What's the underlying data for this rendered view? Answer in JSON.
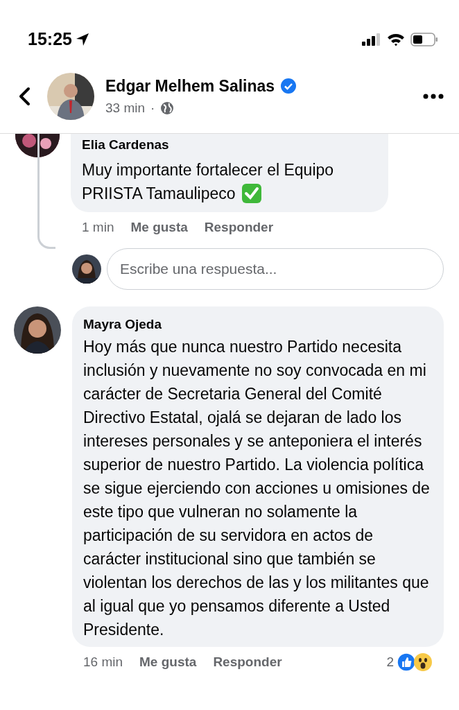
{
  "status_bar": {
    "time": "15:25"
  },
  "header": {
    "name": "Edgar Melhem Salinas",
    "verified": true,
    "time": "33 min",
    "separator": "·"
  },
  "reply_thread": {
    "author": "Elia Cardenas",
    "text_lines": [
      "Muy importante fortalecer el Equipo",
      "PRIISTA Tamaulipeco"
    ],
    "time": "1 min",
    "actions": [
      "Me gusta",
      "Responder"
    ]
  },
  "reply_box": {
    "placeholder": "Escribe una respuesta..."
  },
  "comment": {
    "author": "Mayra Ojeda",
    "text": "Hoy más que nunca nuestro Partido necesita inclusión y nuevamente no soy convocada en mi carácter de Secretaria General del Comité Directivo Estatal, ojalá se dejaran de lado los intereses personales y se anteponiera el interés superior de nuestro Partido. La violencia política se sigue ejerciendo con acciones u omisiones de este tipo que vulneran no solamente la participación de su servidora en actos de carácter institucional sino que también se violentan los derechos de las y los militantes que al igual que yo pensamos diferente a Usted Presidente.",
    "time": "16 min",
    "actions": [
      "Me gusta",
      "Responder"
    ],
    "reaction_count": "2"
  }
}
